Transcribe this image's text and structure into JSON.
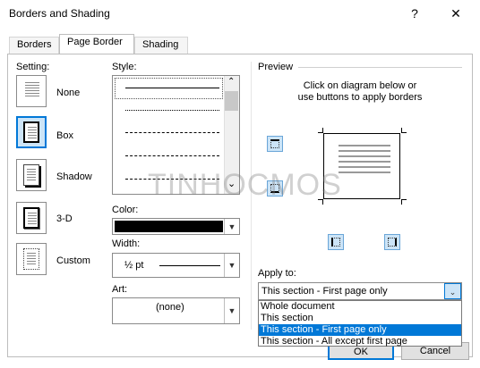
{
  "window": {
    "title": "Borders and Shading",
    "help_glyph": "?",
    "close_glyph": "✕"
  },
  "tabs": [
    {
      "label": "Borders",
      "active": false
    },
    {
      "label": "Page Border",
      "active": true
    },
    {
      "label": "Shading",
      "active": false
    }
  ],
  "setting": {
    "label": "Setting:",
    "options": [
      {
        "label": "None",
        "selected": false
      },
      {
        "label": "Box",
        "selected": true
      },
      {
        "label": "Shadow",
        "selected": false
      },
      {
        "label": "3-D",
        "selected": false
      },
      {
        "label": "Custom",
        "selected": false
      }
    ]
  },
  "style": {
    "label": "Style:",
    "line_styles": [
      "solid",
      "dotted",
      "dashed",
      "dash-long",
      "dash-dot"
    ],
    "scroll_down_glyph": "⌄",
    "scroll_up_glyph": "⌃"
  },
  "color": {
    "label": "Color:",
    "value": "#000000"
  },
  "width": {
    "label": "Width:",
    "value": "½ pt"
  },
  "art": {
    "label": "Art:",
    "value": "(none)"
  },
  "preview": {
    "label": "Preview",
    "instructions_line1": "Click on diagram below or",
    "instructions_line2": "use buttons to apply borders"
  },
  "apply_to": {
    "label": "Apply to:",
    "selected_value": "This section - First page only",
    "options": [
      {
        "label": "Whole document",
        "selected": false
      },
      {
        "label": "This section",
        "selected": false
      },
      {
        "label": "This section - First page only",
        "selected": true
      },
      {
        "label": "This section - All except first page",
        "selected": false
      }
    ]
  },
  "buttons": {
    "ok": "OK",
    "cancel": "Cancel"
  },
  "watermark": "TINHOCMOS",
  "colors": {
    "accent": "#0078d7",
    "selected_bg": "#cce4f7"
  }
}
